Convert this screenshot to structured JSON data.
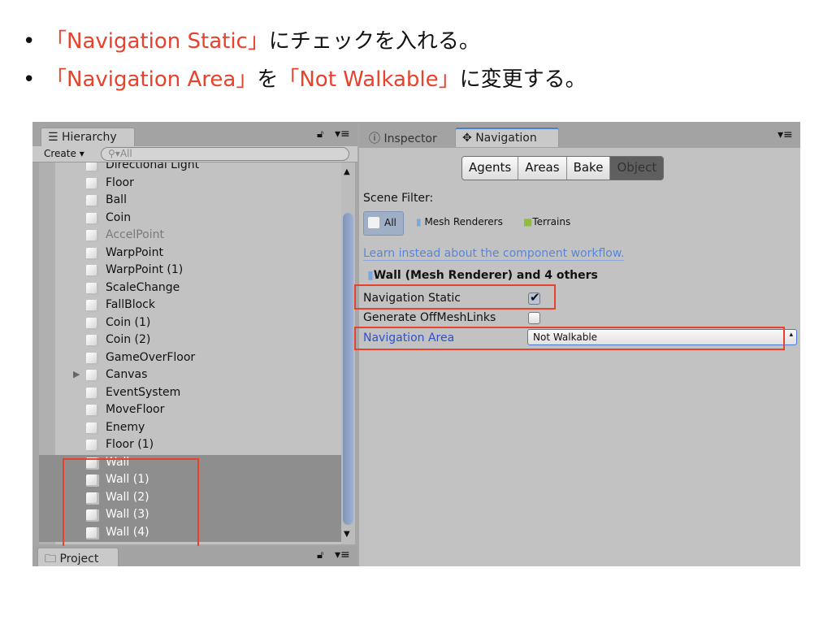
{
  "slide": {
    "bullets": [
      {
        "dot": "•",
        "parts": [
          {
            "text": "「Navigation Static」",
            "highlight": true
          },
          {
            "text": "にチェックを入れる。",
            "highlight": false
          }
        ]
      },
      {
        "dot": "•",
        "parts": [
          {
            "text": "「Navigation Area」",
            "highlight": true
          },
          {
            "text": "を",
            "highlight": false
          },
          {
            "text": "「Not Walkable」",
            "highlight": true
          },
          {
            "text": "に変更する。",
            "highlight": false
          }
        ]
      }
    ]
  },
  "colors": {
    "highlight": "#e8412c",
    "link": "#2f4fd0",
    "selection": "#8e8e8e"
  },
  "hierarchy": {
    "tab": "Hierarchy",
    "create": "Create",
    "search_placeholder": "All",
    "items": [
      {
        "label": "Directional Light",
        "state": "normal"
      },
      {
        "label": "Floor",
        "state": "normal"
      },
      {
        "label": "Ball",
        "state": "normal"
      },
      {
        "label": "Coin",
        "state": "normal"
      },
      {
        "label": "AccelPoint",
        "state": "disabled"
      },
      {
        "label": "WarpPoint",
        "state": "normal"
      },
      {
        "label": "WarpPoint (1)",
        "state": "normal"
      },
      {
        "label": "ScaleChange",
        "state": "normal"
      },
      {
        "label": "FallBlock",
        "state": "normal"
      },
      {
        "label": "Coin (1)",
        "state": "normal"
      },
      {
        "label": "Coin (2)",
        "state": "normal"
      },
      {
        "label": "GameOverFloor",
        "state": "normal"
      },
      {
        "label": "Canvas",
        "state": "normal",
        "expandable": true
      },
      {
        "label": "EventSystem",
        "state": "normal"
      },
      {
        "label": "MoveFloor",
        "state": "normal"
      },
      {
        "label": "Enemy",
        "state": "normal"
      },
      {
        "label": "Floor (1)",
        "state": "normal"
      },
      {
        "label": "Wall",
        "state": "selected"
      },
      {
        "label": "Wall (1)",
        "state": "selected"
      },
      {
        "label": "Wall (2)",
        "state": "selected"
      },
      {
        "label": "Wall (3)",
        "state": "selected"
      },
      {
        "label": "Wall (4)",
        "state": "selected"
      }
    ]
  },
  "project": {
    "tab": "Project"
  },
  "inspector": {
    "tab_inspector": "Inspector",
    "tab_navigation": "Navigation",
    "segments": [
      "Agents",
      "Areas",
      "Bake",
      "Object"
    ],
    "active_segment": "Object",
    "scene_filter_label": "Scene Filter:",
    "filters": [
      "All",
      "Mesh Renderers",
      "Terrains"
    ],
    "active_filter": "All",
    "link": "Learn instead about the component workflow.",
    "selection_title": "Wall (Mesh Renderer) and 4 others",
    "navigation_static": {
      "label": "Navigation Static",
      "checked": true
    },
    "generate_offmesh": {
      "label": "Generate OffMeshLinks",
      "checked": false
    },
    "navigation_area": {
      "label": "Navigation Area",
      "value": "Not Walkable"
    }
  }
}
